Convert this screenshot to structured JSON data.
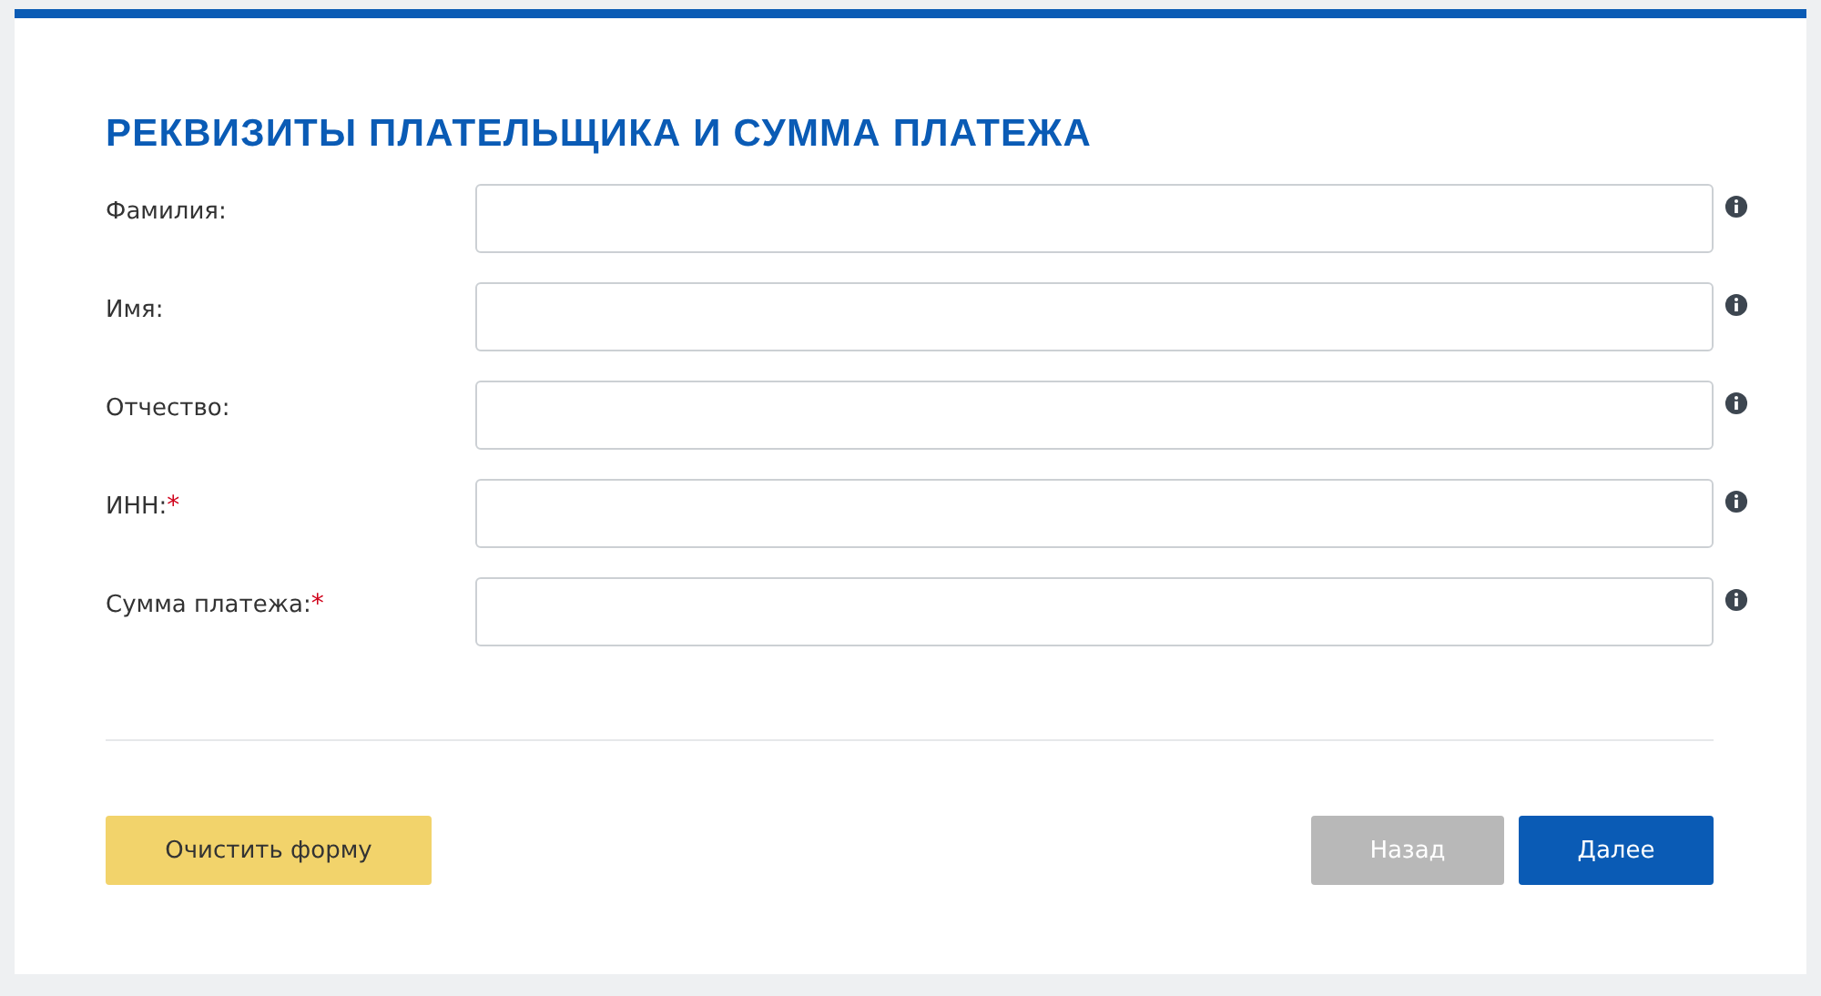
{
  "form": {
    "title": "РЕКВИЗИТЫ ПЛАТЕЛЬЩИКА И СУММА ПЛАТЕЖА",
    "fields": [
      {
        "label": "Фамилия:"
      },
      {
        "label": "Имя:"
      },
      {
        "label": "Отчество:"
      },
      {
        "label": "ИНН:",
        "required_mark": "*"
      },
      {
        "label": "Сумма платежа:",
        "required_mark": "*"
      }
    ],
    "buttons": [
      {
        "label": "Очистить форму",
        "kind": "secondary",
        "disabled": false
      },
      {
        "label": "Назад",
        "kind": "back",
        "disabled": true
      },
      {
        "label": "Далее",
        "kind": "primary",
        "disabled": false
      }
    ]
  }
}
